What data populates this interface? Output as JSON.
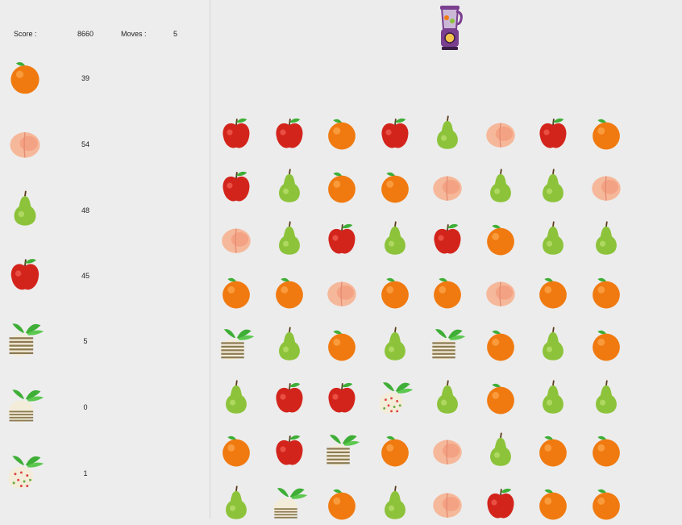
{
  "hud": {
    "score_label": "Score :",
    "score_value": "8660",
    "moves_label": "Moves :",
    "moves_value": "5"
  },
  "top_icon": "blender-icon",
  "goals": [
    {
      "fruit": "orange",
      "count": "39"
    },
    {
      "fruit": "peach",
      "count": "54"
    },
    {
      "fruit": "pear",
      "count": "48"
    },
    {
      "fruit": "apple",
      "count": "45"
    },
    {
      "fruit": "turnip-striped",
      "count": "5"
    },
    {
      "fruit": "turnip-band",
      "count": "0"
    },
    {
      "fruit": "turnip-dotted",
      "count": "1"
    }
  ],
  "board": [
    [
      "apple",
      "apple",
      "orange",
      "apple",
      "pear",
      "peach",
      "apple",
      "orange"
    ],
    [
      "apple",
      "pear",
      "orange",
      "orange",
      "peach",
      "pear",
      "pear",
      "peach"
    ],
    [
      "peach",
      "pear",
      "apple",
      "pear",
      "apple",
      "orange",
      "pear",
      "pear"
    ],
    [
      "orange",
      "orange",
      "peach",
      "orange",
      "orange",
      "peach",
      "orange",
      "orange"
    ],
    [
      "turnip-striped",
      "pear",
      "orange",
      "pear",
      "turnip-striped",
      "orange",
      "pear",
      "orange"
    ],
    [
      "pear",
      "apple",
      "apple",
      "turnip-dotted",
      "pear",
      "orange",
      "pear",
      "pear"
    ],
    [
      "orange",
      "apple",
      "turnip-striped",
      "orange",
      "peach",
      "pear",
      "orange",
      "orange"
    ],
    [
      "pear",
      "turnip-band",
      "orange",
      "pear",
      "peach",
      "apple",
      "orange",
      "orange"
    ]
  ],
  "colors": {
    "orange": "#f07a10",
    "apple": "#d3241c",
    "pear": "#8cc33a",
    "peach": "#f6b89a",
    "leaf": "#3fae37",
    "turnip": "#b9a986",
    "blender": "#7a3f8f"
  }
}
